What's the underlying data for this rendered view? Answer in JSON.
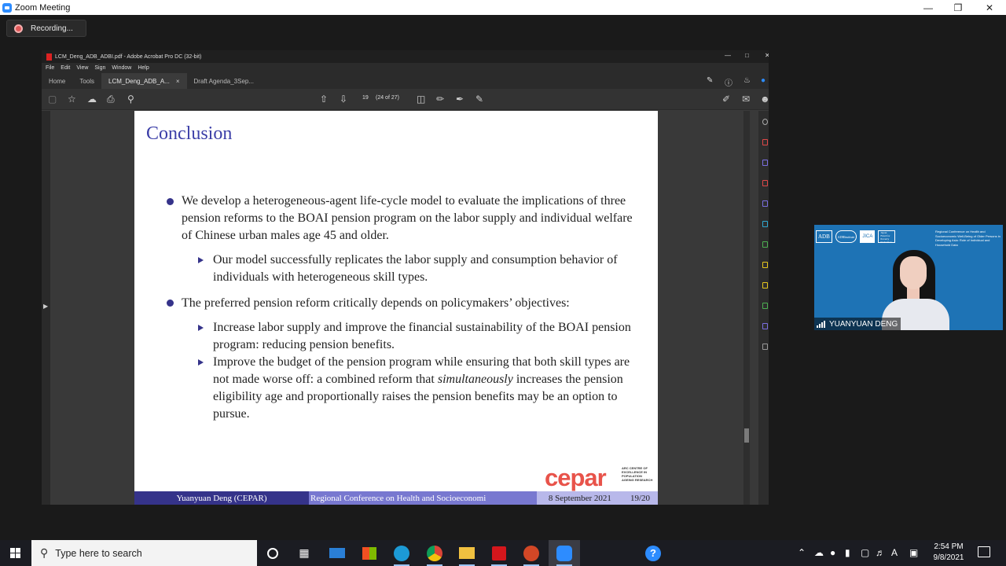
{
  "zoom": {
    "title": "Zoom Meeting",
    "recording_label": "Recording..."
  },
  "acrobat": {
    "title": "LCM_Deng_ADB_ADBI.pdf - Adobe Acrobat Pro DC (32-bit)",
    "menu": [
      "File",
      "Edit",
      "View",
      "Sign",
      "Window",
      "Help"
    ],
    "tabs": [
      {
        "label": "Home"
      },
      {
        "label": "Tools"
      },
      {
        "label": "LCM_Deng_ADB_A...",
        "close": "×"
      },
      {
        "label": "Draft Agenda_3Sep..."
      }
    ],
    "page_current": "19",
    "page_info": "(24 of 27)"
  },
  "slide": {
    "title": "Conclusion",
    "bullet1": "We develop a heterogeneous-agent life-cycle model to evaluate the implications of three pension reforms to the BOAI pension program on the labor supply and individual welfare of Chinese urban males age 45 and older.",
    "sub1": "Our model successfully replicates the labor supply and consumption behavior of individuals with heterogeneous skill types.",
    "bullet2": "The preferred pension reform critically depends on policymakers’ objectives:",
    "sub2": "Increase labor supply and improve the financial sustainability of the BOAI pension program: reducing pension benefits.",
    "sub3_a": "Improve the budget of the pension program while ensuring that both skill types are not made worse off: a combined reform that ",
    "sub3_em": "simultaneously",
    "sub3_b": " increases the pension eligibility age and proportionally raises the pension benefits may be an option to pursue.",
    "logo_text": "cepar",
    "logo_subtext": "ARC CENTRE OF EXCELLENCE IN POPULATION AGEING RESEARCH",
    "footer_author": "Yuanyuan Deng (CEPAR)",
    "footer_conf": "Regional Conference on Health and Socioeconomi",
    "footer_date": "8 September 2021",
    "footer_page": "19/20"
  },
  "video": {
    "participant_name": "YUANYUAN DENG",
    "logo1": "ADB",
    "logo2": "ADBInstitute",
    "logo3": "JICA",
    "logo4": "Japan Fund for Poverty Reduction",
    "conference_text": "Regional Conference on Health and Socioeconomic Well-Being of Older Persons in Developing Asia: Role of Individual and Household Data"
  },
  "taskbar": {
    "search_placeholder": "Type here to search",
    "time": "2:54 PM",
    "date": "9/8/2021",
    "apps": [
      "task-view",
      "file-explorer-mail",
      "store",
      "edge",
      "chrome",
      "folder",
      "acrobat",
      "powerpoint",
      "zoom",
      "help"
    ]
  }
}
